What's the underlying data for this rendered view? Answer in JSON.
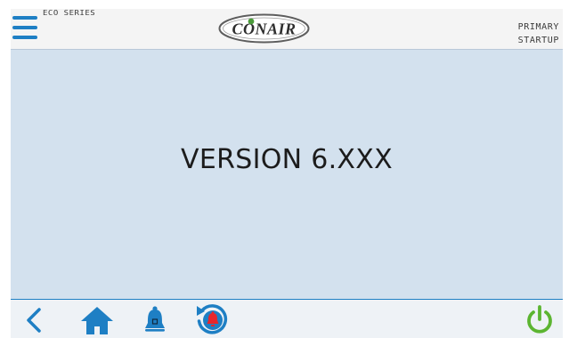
{
  "header": {
    "series_label": "ECO SERIES",
    "logo_text": "CONAIR",
    "mode_line1": "PRIMARY",
    "mode_line2": "STARTUP"
  },
  "main": {
    "version_text": "VERSION 6.XXX"
  },
  "icons": {
    "menu": "hamburger-menu-icon",
    "back": "chevron-left-icon",
    "home": "home-icon",
    "alarm": "bell-icon",
    "alarm_history": "alarm-history-icon",
    "power": "power-icon"
  },
  "colors": {
    "accent_blue": "#1e7fc4",
    "main_background": "#d3e1ee",
    "alarm_red": "#e8262b",
    "power_green": "#5cb531"
  }
}
